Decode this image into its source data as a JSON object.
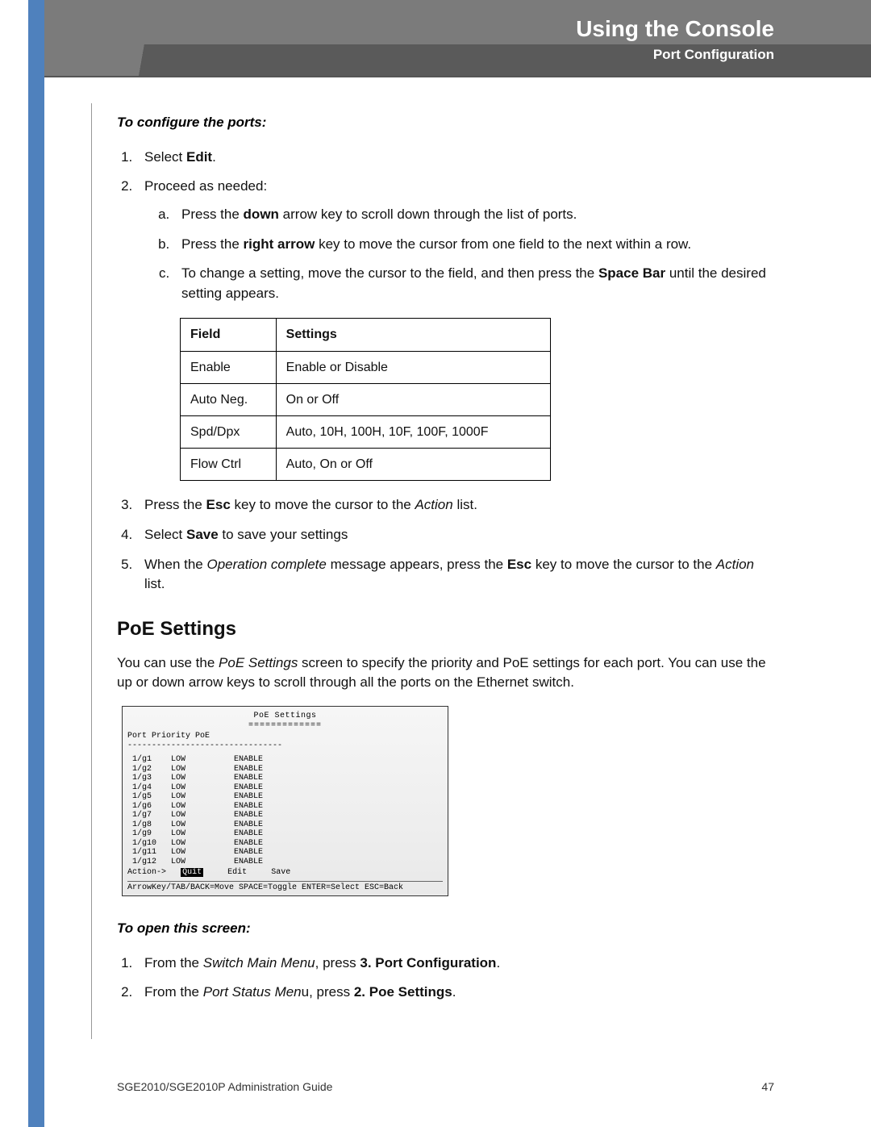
{
  "header": {
    "chapter": "Using the Console",
    "section": "Port Configuration"
  },
  "intro_sub": "To configure the ports:",
  "step1_pre": "Select ",
  "step1_b": "Edit",
  "step1_post": ".",
  "step2": "Proceed as needed:",
  "sub_a_pre": "Press the ",
  "sub_a_b": "down",
  "sub_a_post": " arrow key to scroll down through the list of ports.",
  "sub_b_pre": "Press the ",
  "sub_b_b": "right arrow",
  "sub_b_post": " key to move the cursor from one field to the next within a row.",
  "sub_c_pre": "To change a setting, move the cursor to the field, and then press the ",
  "sub_c_b": "Space Bar",
  "sub_c_post": " until the desired setting appears.",
  "table": {
    "h1": "Field",
    "h2": "Settings",
    "rows": [
      {
        "f": "Enable",
        "s": "Enable or Disable"
      },
      {
        "f": "Auto Neg.",
        "s": "On or Off"
      },
      {
        "f": "Spd/Dpx",
        "s": "Auto, 10H, 100H, 10F, 100F, 1000F"
      },
      {
        "f": "Flow Ctrl",
        "s": "Auto, On or Off"
      }
    ]
  },
  "step3_pre": "Press the ",
  "step3_b": "Esc",
  "step3_mid": " key to move the cursor to the ",
  "step3_it": "Action",
  "step3_post": " list.",
  "step4_pre": "Select ",
  "step4_b": "Save",
  "step4_post": " to save your settings",
  "step5_pre": "When the ",
  "step5_it1": "Operation complete",
  "step5_mid1": " message appears, press the ",
  "step5_b": "Esc",
  "step5_mid2": " key to move the cursor to the ",
  "step5_it2": "Action",
  "step5_post": " list.",
  "poe_heading": "PoE Settings",
  "poe_para_pre": "You can use the ",
  "poe_para_it": "PoE Settings",
  "poe_para_post": " screen to specify the priority and PoE settings for each port. You can use the up or down arrow keys to scroll through all the ports on the Ethernet switch.",
  "console": {
    "title": "PoE Settings",
    "underline": "=============",
    "col_header": "  Port    Priority      PoE",
    "dashes": "--------------------------------",
    "rows": [
      " 1/g1    LOW          ENABLE",
      " 1/g2    LOW          ENABLE",
      " 1/g3    LOW          ENABLE",
      " 1/g4    LOW          ENABLE",
      " 1/g5    LOW          ENABLE",
      " 1/g6    LOW          ENABLE",
      " 1/g7    LOW          ENABLE",
      " 1/g8    LOW          ENABLE",
      " 1/g9    LOW          ENABLE",
      " 1/g10   LOW          ENABLE",
      " 1/g11   LOW          ENABLE",
      " 1/g12   LOW          ENABLE"
    ],
    "action_label": "Action->",
    "action_quit": "Quit",
    "action_edit": "Edit",
    "action_save": "Save",
    "help": "ArrowKey/TAB/BACK=Move   SPACE=Toggle   ENTER=Select   ESC=Back"
  },
  "open_sub": "To open this screen:",
  "open1_pre": "From the ",
  "open1_it": "Switch Main Menu",
  "open1_mid": ", press ",
  "open1_b": "3. Port Configuration",
  "open1_post": ".",
  "open2_pre": "From the ",
  "open2_it": "Port Status Men",
  "open2_mid": "u, press ",
  "open2_b": "2. Poe Settings",
  "open2_post": ".",
  "footer": {
    "guide": "SGE2010/SGE2010P Administration Guide",
    "page": "47"
  }
}
